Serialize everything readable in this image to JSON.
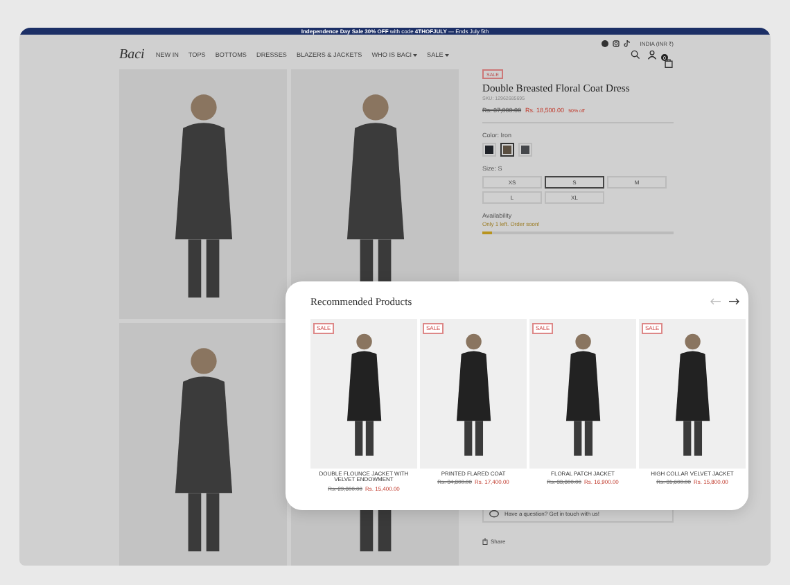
{
  "banner": {
    "text": "**Independence Day Sale 30% OFF** with code **4THOFJULY** — Ends July 5th"
  },
  "header": {
    "logo": "Baci",
    "nav": [
      {
        "label": "NEW IN",
        "dropdown": false
      },
      {
        "label": "TOPS",
        "dropdown": false
      },
      {
        "label": "BOTTOMS",
        "dropdown": false
      },
      {
        "label": "DRESSES",
        "dropdown": false
      },
      {
        "label": "BLAZERS & JACKETS",
        "dropdown": false
      },
      {
        "label": "WHO IS BACI",
        "dropdown": true
      },
      {
        "label": "SALE",
        "dropdown": true
      }
    ],
    "locale": "INDIA (INR ₹)",
    "cart_count": "0"
  },
  "product": {
    "badge": "SALE",
    "title": "Double Breasted Floral Coat Dress",
    "sku": "SKU: 12962685695",
    "old_price": "Rs. 37,000.00",
    "price": "Rs. 18,500.00",
    "discount": "50% off",
    "color_label": "Color: Iron",
    "swatches": [
      {
        "color": "#1f2228",
        "selected": false
      },
      {
        "color": "#5a4e40",
        "selected": true
      },
      {
        "color": "#45474b",
        "selected": false
      }
    ],
    "size_label": "Size: S",
    "sizes": [
      {
        "label": "XS",
        "selected": false
      },
      {
        "label": "S",
        "selected": true
      },
      {
        "label": "M",
        "selected": false
      },
      {
        "label": "L",
        "selected": false
      },
      {
        "label": "XL",
        "selected": false
      }
    ],
    "availability_label": "Availability",
    "availability": "Only 1 left. Order soon!",
    "stock_bar": {
      "level": 0.05
    },
    "contact": "Have a question? Get in touch with us!",
    "share": "Share"
  },
  "recommended": {
    "title": "Recommended Products",
    "products": [
      {
        "badge": "SALE",
        "name": "DOUBLE FLOUNCE JACKET WITH VELVET ENDOWMENT",
        "old_price": "Rs. 29,800.00",
        "price": "Rs. 15,400.00"
      },
      {
        "badge": "SALE",
        "name": "PRINTED FLARED COAT",
        "old_price": "Rs. 34,800.00",
        "price": "Rs. 17,400.00"
      },
      {
        "badge": "SALE",
        "name": "FLORAL PATCH JACKET",
        "old_price": "Rs. 33,800.00",
        "price": "Rs. 16,900.00"
      },
      {
        "badge": "SALE",
        "name": "HIGH COLLAR VELVET JACKET",
        "old_price": "Rs. 31,600.00",
        "price": "Rs. 15,800.00"
      }
    ]
  }
}
